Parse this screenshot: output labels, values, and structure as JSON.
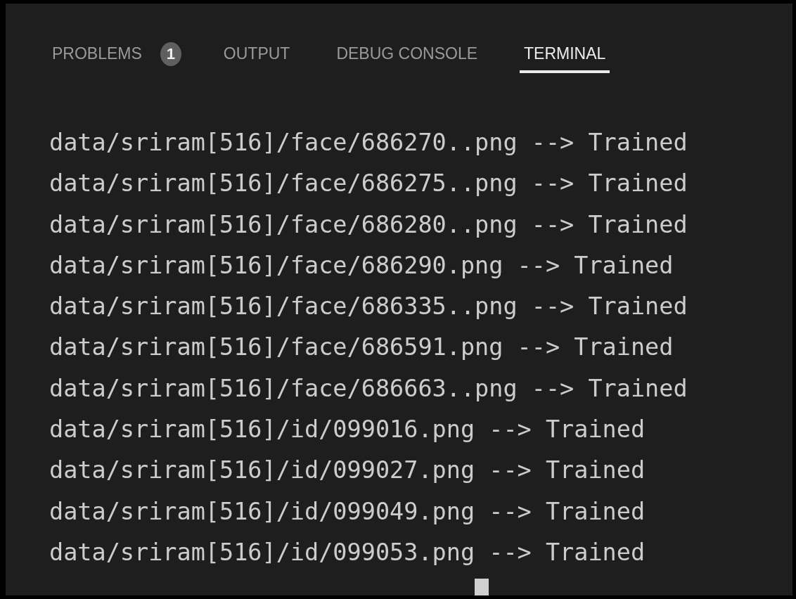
{
  "panel": {
    "tabs": [
      {
        "label": "PROBLEMS",
        "badge": "1",
        "selected": false
      },
      {
        "label": "OUTPUT",
        "selected": false
      },
      {
        "label": "DEBUG CONSOLE",
        "selected": false
      },
      {
        "label": "TERMINAL",
        "selected": true
      }
    ],
    "terminal": {
      "lines": [
        "data/sriram[516]/face/686270..png --> Trained",
        "data/sriram[516]/face/686275..png --> Trained",
        "data/sriram[516]/face/686280..png --> Trained",
        "data/sriram[516]/face/686290.png --> Trained",
        "data/sriram[516]/face/686335..png --> Trained",
        "data/sriram[516]/face/686591.png --> Trained",
        "data/sriram[516]/face/686663..png --> Trained",
        "data/sriram[516]/id/099016.png --> Trained",
        "data/sriram[516]/id/099027.png --> Trained",
        "data/sriram[516]/id/099049.png --> Trained",
        "data/sriram[516]/id/099053.png --> Trained"
      ]
    }
  }
}
